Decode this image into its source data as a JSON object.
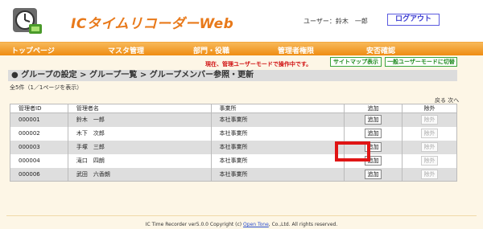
{
  "header": {
    "app_title": "ICタイムリコーダーWeb",
    "user_label": "ユーザー：鈴木　一郎",
    "logout_label": "ログアウト"
  },
  "nav": {
    "items": [
      {
        "label": "トップページ"
      },
      {
        "label": "マスタ管理"
      },
      {
        "label": "部門・役職"
      },
      {
        "label": "管理者権限"
      },
      {
        "label": "安否確認"
      }
    ]
  },
  "mode_bar": {
    "message": "現在、管理ユーザーモードで操作中です。",
    "sitemap_label": "サイトマップ表示",
    "user_mode_label": "一般ユーザーモードに切替"
  },
  "breadcrumb": "● グループの設定 > グループ一覧 > グループメンバー参照・更新",
  "count_text": "全5件（1／1ページを表示）",
  "pager": {
    "prev": "戻る",
    "next": "次へ"
  },
  "table": {
    "headers": [
      "管理者ID",
      "管理者名",
      "事業所",
      "追加",
      "除外"
    ],
    "rows": [
      {
        "id": "000001",
        "name": "鈴木　一郎",
        "office": "本社事業所",
        "add": "追加",
        "remove": "除外"
      },
      {
        "id": "000002",
        "name": "木下　次郎",
        "office": "本社事業所",
        "add": "追加",
        "remove": "除外"
      },
      {
        "id": "000003",
        "name": "手塚　三郎",
        "office": "本社事業所",
        "add": "追加",
        "remove": "除外"
      },
      {
        "id": "000004",
        "name": "滝口　四朗",
        "office": "本社事業所",
        "add": "追加",
        "remove": "除外"
      },
      {
        "id": "000006",
        "name": "武田　六香朗",
        "office": "本社事業所",
        "add": "追加",
        "remove": "除外"
      }
    ]
  },
  "footer": {
    "prefix": "IC Time Recorder ver5.0.0 Copyright (c)",
    "link": "Open Tone",
    "suffix": ", Co.,Ltd. All rights reserved."
  },
  "colors": {
    "accent": "#ef8c12",
    "title": "#e8791a",
    "highlight": "#e01515"
  }
}
